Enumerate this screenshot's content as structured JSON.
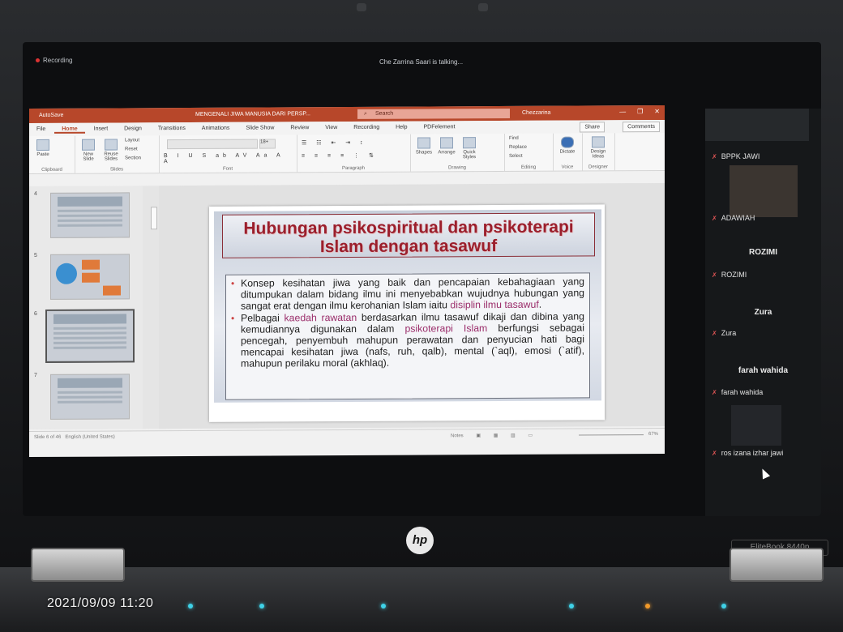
{
  "zoom": {
    "recording_label": "Recording",
    "talking_status": "Che Zarrina Saari is talking..."
  },
  "powerpoint": {
    "autosave": "AutoSave",
    "document_title": "MENGENALI JIWA MANUSIA DARI PERSP...",
    "search_placeholder": "Search",
    "user_name": "Chezzarina",
    "tabs": [
      "File",
      "Home",
      "Insert",
      "Design",
      "Transitions",
      "Animations",
      "Slide Show",
      "Review",
      "View",
      "Recording",
      "Help",
      "PDFelement"
    ],
    "share_label": "Share",
    "comments_label": "Comments",
    "ribbon": {
      "clipboard": {
        "name": "Clipboard",
        "paste": "Paste"
      },
      "slides": {
        "name": "Slides",
        "new_slide": "New Slide",
        "reuse_slides": "Reuse Slides",
        "layout": "Layout",
        "reset": "Reset",
        "section": "Section"
      },
      "font": {
        "name": "Font",
        "size": "18+"
      },
      "paragraph": {
        "name": "Paragraph"
      },
      "drawing": {
        "name": "Drawing",
        "shapes": "Shapes",
        "arrange": "Arrange",
        "quick_styles": "Quick Styles"
      },
      "editing": {
        "name": "Editing",
        "find": "Find",
        "replace": "Replace",
        "select": "Select"
      },
      "voice": {
        "name": "Voice",
        "dictate": "Dictate"
      },
      "designer": {
        "name": "Designer",
        "design_ideas": "Design Ideas"
      }
    },
    "thumbnail_numbers": [
      "4",
      "5",
      "6",
      "7"
    ],
    "status_left": "Slide 6 of 46",
    "status_lang": "English (United States)",
    "status_notes": "Notes",
    "zoom_level": "67%"
  },
  "slide": {
    "title": "Hubungan psikospiritual dan psikoterapi Islam dengan tasawuf",
    "bullet1_a": "Konsep kesihatan jiwa yang baik dan pencapaian kebahagiaan yang ditumpukan dalam bidang ilmu ini menyebabkan wujudnya hubungan yang sangat erat dengan ilmu kerohanian Islam iaitu ",
    "bullet1_hl": "disiplin ilmu tasawuf",
    "bullet1_end": ".",
    "bullet2_a": "Pelbagai ",
    "bullet2_hl1": "kaedah rawatan",
    "bullet2_b": " berdasarkan ilmu tasawuf dikaji dan dibina yang kemudiannya digunakan dalam ",
    "bullet2_hl2": "psikoterapi Islam",
    "bullet2_c": " berfungsi sebagai pencegah, penyembuh mahupun perawatan dan penyucian hati bagi mencapai kesihatan jiwa (nafs, ruh, qalb), mental (`aql), emosi (`atif), mahupun perilaku moral (akhlaq)."
  },
  "participants": {
    "p1": "BPPK JAWI",
    "p2": "ADAWIAH",
    "p3_big": "ROZIMI",
    "p3": "ROZIMI",
    "p4_big": "Zura",
    "p4": "Zura",
    "p5_big": "farah wahida",
    "p5": "farah wahida",
    "p6": "ros izana izhar jawi"
  },
  "laptop": {
    "brand": "hp",
    "model": "EliteBook 8440p"
  },
  "photo_timestamp": "2021/09/09 11:20",
  "colors": {
    "ppt_accent": "#b7472a",
    "slide_title": "#9b1f2c",
    "highlight_text": "#9b2e6b",
    "mic_muted": "#e05555"
  }
}
